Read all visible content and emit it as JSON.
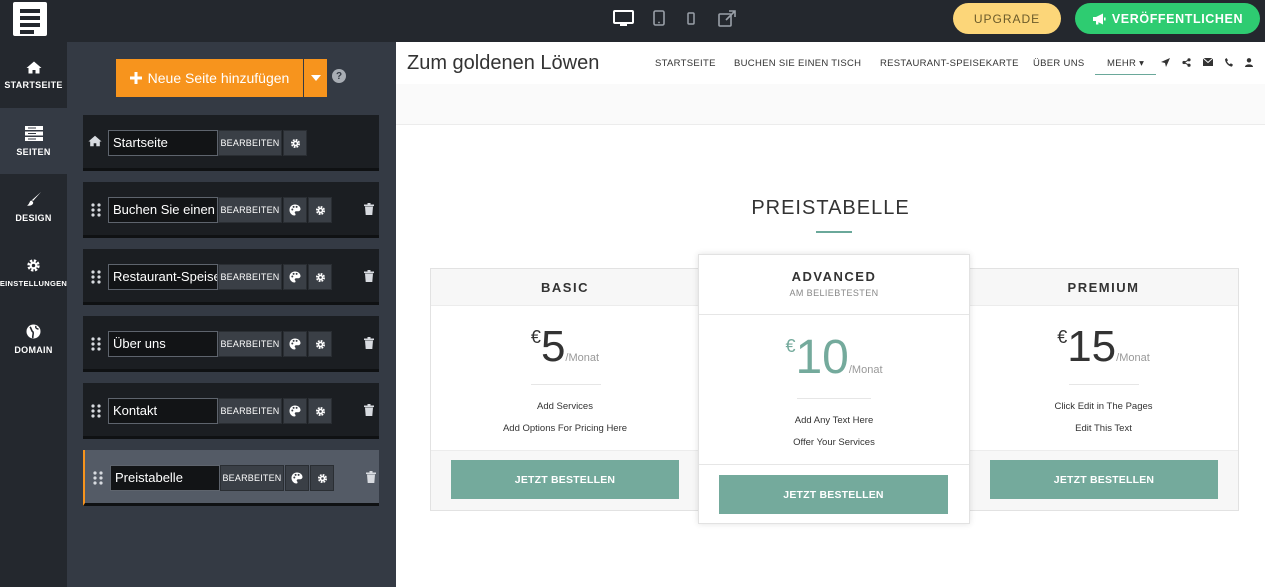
{
  "topbar": {
    "upgrade_label": "UPGRADE",
    "publish_label": "VERÖFFENTLICHEN",
    "devices": [
      "desktop-icon",
      "tablet-icon",
      "mobile-icon",
      "external-link-icon"
    ]
  },
  "leftnav": {
    "items": [
      {
        "label": "STARTSEITE",
        "icon": "home-icon"
      },
      {
        "label": "SEITEN",
        "icon": "pages-icon"
      },
      {
        "label": "DESIGN",
        "icon": "brush-icon"
      },
      {
        "label": "EINSTELLUNGEN",
        "icon": "gear-icon"
      },
      {
        "label": "DOMAIN",
        "icon": "globe-icon"
      }
    ],
    "active": "SEITEN"
  },
  "pages_panel": {
    "add_label": "Neue Seite hinzufügen",
    "edit_label": "BEARBEITEN",
    "pages": [
      {
        "name": "Startseite"
      },
      {
        "name": "Buchen Sie einen Tisch"
      },
      {
        "name": "Restaurant-Speisekarte"
      },
      {
        "name": "Über uns"
      },
      {
        "name": "Kontakt"
      },
      {
        "name": "Preistabelle"
      }
    ],
    "selected": "Preistabelle"
  },
  "site": {
    "name": "Zum goldenen Löwen",
    "menu": [
      "STARTSEITE",
      "BUCHEN SIE EINEN TISCH",
      "RESTAURANT-SPEISEKARTE",
      "ÜBER UNS",
      "MEHR"
    ],
    "nav_icons": [
      "location-arrow-icon",
      "share-icon",
      "envelope-icon",
      "phone-icon",
      "user-icon"
    ]
  },
  "pricing": {
    "title": "PREISTABELLE",
    "accent": "#74aa9c",
    "plans": [
      {
        "name": "BASIC",
        "currency": "€",
        "price": "5",
        "period": "/Monat",
        "features": [
          "Add Services",
          "Add Options For Pricing Here"
        ],
        "button": "JETZT BESTELLEN"
      },
      {
        "name": "ADVANCED",
        "subtitle": "AM BELIEBTESTEN",
        "currency": "€",
        "price": "10",
        "period": "/Monat",
        "features": [
          "Add Any Text Here",
          "Offer Your Services"
        ],
        "button": "JETZT BESTELLEN"
      },
      {
        "name": "PREMIUM",
        "currency": "€",
        "price": "15",
        "period": "/Monat",
        "features": [
          "Click Edit in The Pages",
          "Edit This Text"
        ],
        "button": "JETZT BESTELLEN"
      }
    ]
  }
}
